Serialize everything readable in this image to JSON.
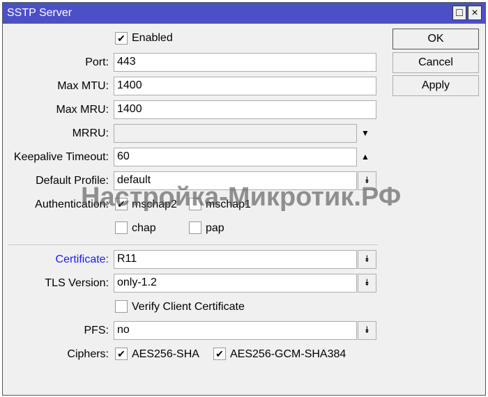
{
  "window": {
    "title": "SSTP Server",
    "maximize_icon": "□",
    "close_icon": "×"
  },
  "buttons": {
    "ok": "OK",
    "cancel": "Cancel",
    "apply": "Apply"
  },
  "enabled": {
    "label": "Enabled",
    "checked": true
  },
  "fields": {
    "port": {
      "label": "Port:",
      "value": "443"
    },
    "max_mtu": {
      "label": "Max MTU:",
      "value": "1400"
    },
    "max_mru": {
      "label": "Max MRU:",
      "value": "1400"
    },
    "mrru": {
      "label": "MRRU:",
      "value": ""
    },
    "keepalive": {
      "label": "Keepalive Timeout:",
      "value": "60"
    },
    "default_profile": {
      "label": "Default Profile:",
      "value": "default"
    },
    "certificate": {
      "label": "Certificate:",
      "value": "R11"
    },
    "tls_version": {
      "label": "TLS Version:",
      "value": "only-1.2"
    },
    "pfs": {
      "label": "PFS:",
      "value": "no"
    }
  },
  "authentication": {
    "label": "Authentication:",
    "options": [
      {
        "label": "mschap2",
        "checked": true
      },
      {
        "label": "mschap1",
        "checked": false
      },
      {
        "label": "chap",
        "checked": false
      },
      {
        "label": "pap",
        "checked": false
      }
    ]
  },
  "verify_client_certificate": {
    "label": "Verify Client Certificate",
    "checked": false
  },
  "ciphers": {
    "label": "Ciphers:",
    "options": [
      {
        "label": "AES256-SHA",
        "checked": true
      },
      {
        "label": "AES256-GCM-SHA384",
        "checked": true
      }
    ]
  },
  "icons": {
    "check": "✔",
    "down": "▼",
    "up": "▲",
    "dropdown": "⯯"
  },
  "watermark": "Настройка-Микротик.РФ",
  "colors": {
    "titlebar": "#4b50c8",
    "link_label": "#1a1aff"
  }
}
